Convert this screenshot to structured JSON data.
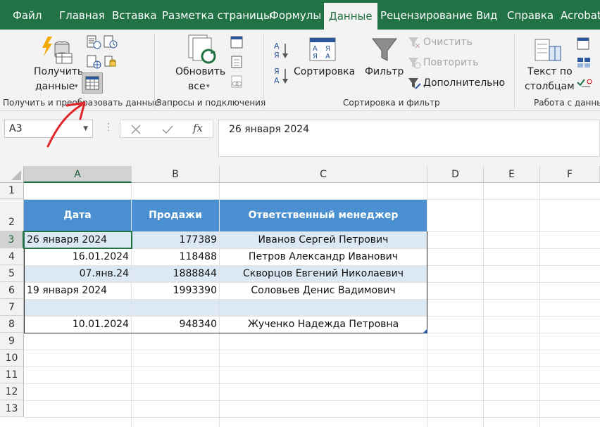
{
  "menu": {
    "tabs": [
      "Файл",
      "Главная",
      "Вставка",
      "Разметка страницы",
      "Формулы",
      "Данные",
      "Рецензирование",
      "Вид",
      "Справка",
      "Acrobat"
    ],
    "active_tab": "Данные"
  },
  "ribbon": {
    "get_data_line1": "Получить",
    "get_data_line2": "данные",
    "refresh_line1": "Обновить",
    "refresh_line2": "все",
    "sort_button": "Сортировка",
    "filter_button": "Фильтр",
    "clear_button": "Очистить",
    "reapply_button": "Повторить",
    "advanced_button": "Дополнительно",
    "text_to_columns_line1": "Текст по",
    "text_to_columns_line2": "столбцам",
    "group_get_transform": "Получить и преобразовать данные",
    "group_queries": "Запросы и подключения",
    "group_sort_filter": "Сортировка и фильтр",
    "group_data_tools": "Работа с данными"
  },
  "formula_bar": {
    "name_box": "A3",
    "fx_label": "fx",
    "value": "26 января 2024"
  },
  "sheet": {
    "columns": [
      "A",
      "B",
      "C",
      "D",
      "E",
      "F"
    ],
    "selected_column": "A",
    "rows": [
      "1",
      "2",
      "3",
      "4",
      "5",
      "6",
      "7",
      "8",
      "9",
      "10",
      "11",
      "12",
      "13"
    ],
    "selected_row": "3",
    "headers": [
      "Дата",
      "Продажи",
      "Ответственный менеджер"
    ],
    "data": [
      [
        "26 января 2024",
        "177389",
        "Иванов Сергей Петрович"
      ],
      [
        "16.01.2024",
        "118488",
        "Петров Александр Иванович"
      ],
      [
        "07.янв.24",
        "1888844",
        "Скворцов Евгений Николаевич"
      ],
      [
        "19 января 2024",
        "1993390",
        "Соловьев Денис Вадимович"
      ],
      [
        "",
        "",
        ""
      ],
      [
        "10.01.2024",
        "948340",
        "Жученко Надежда Петровна"
      ]
    ]
  },
  "colors": {
    "excel_green": "#217346",
    "table_header_blue": "#4a90d0",
    "band_blue": "#dce9f5",
    "annotation_arrow_red": "#e0242a"
  }
}
